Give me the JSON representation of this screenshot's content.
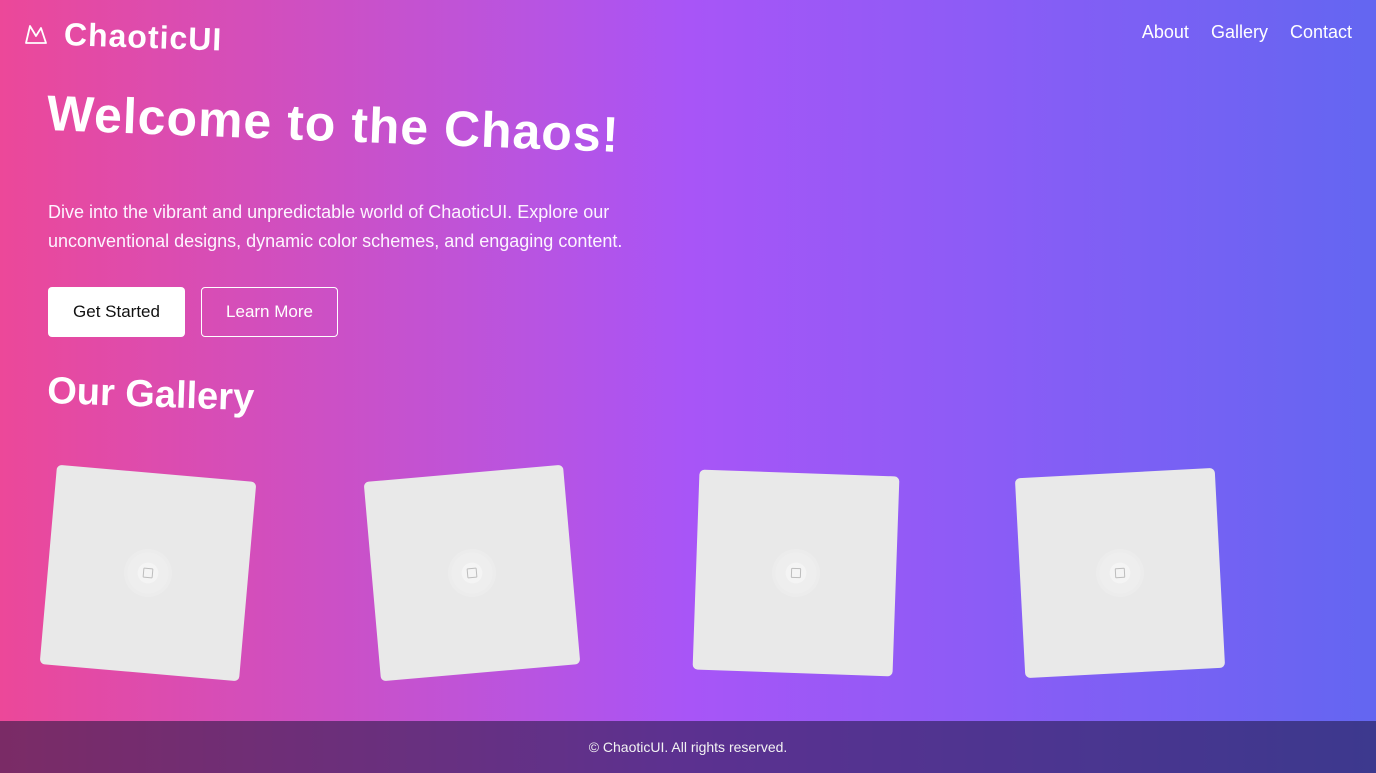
{
  "brand": {
    "name": "ChaoticUI",
    "icon": "mountain-icon"
  },
  "nav": {
    "items": [
      "About",
      "Gallery",
      "Contact"
    ]
  },
  "hero": {
    "title": "Welcome to the Chaos!",
    "description": "Dive into the vibrant and unpredictable world of ChaoticUI. Explore our unconventional designs, dynamic color schemes, and engaging content.",
    "primary_label": "Get Started",
    "secondary_label": "Learn More"
  },
  "gallery": {
    "title": "Our Gallery",
    "placeholder_icon": "image-placeholder-icon"
  },
  "footer": {
    "text": "© ChaoticUI. All rights reserved."
  },
  "colors": {
    "gradient_start": "#ec4899",
    "gradient_mid": "#a855f7",
    "gradient_end": "#6366f1",
    "card_bg": "#e9e9e9",
    "button_primary_bg": "#ffffff"
  }
}
